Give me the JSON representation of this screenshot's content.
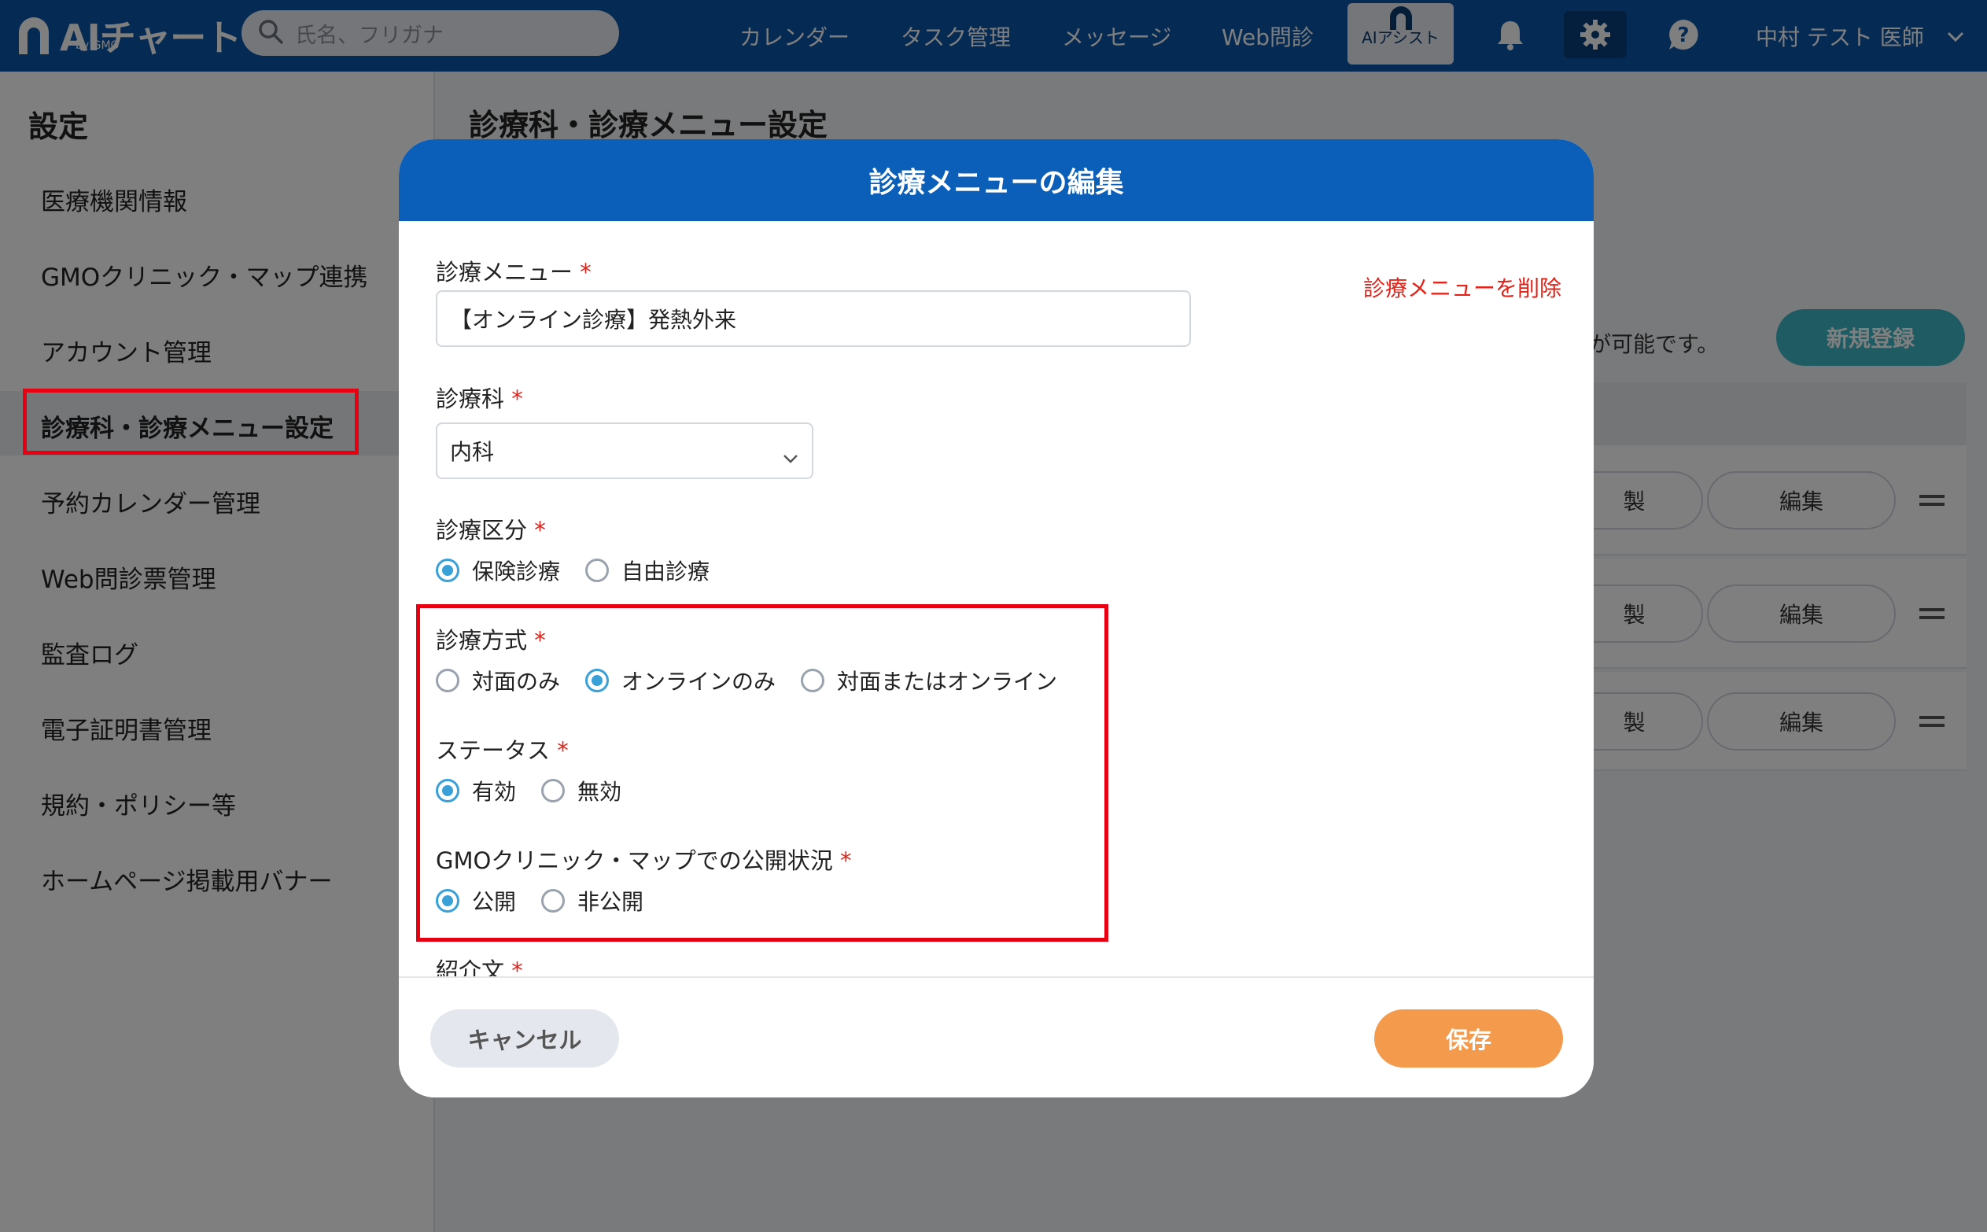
{
  "header": {
    "logo_text": "AIチャート",
    "logo_sub": "by GMO",
    "search_placeholder": "氏名、フリガナ",
    "nav": [
      "カレンダー",
      "タスク管理",
      "メッセージ",
      "Web問診"
    ],
    "ai_assist_label": "AIアシスト",
    "user_name": "中村 テスト 医師"
  },
  "sidebar": {
    "title": "設定",
    "items": [
      {
        "label": "医療機関情報"
      },
      {
        "label": "GMOクリニック・マップ連携"
      },
      {
        "label": "アカウント管理"
      },
      {
        "label": "診療科・診療メニュー設定"
      },
      {
        "label": "予約カレンダー管理"
      },
      {
        "label": "Web問診票管理"
      },
      {
        "label": "監査ログ"
      },
      {
        "label": "電子証明書管理"
      },
      {
        "label": "規約・ポリシー等"
      },
      {
        "label": "ホームページ掲載用バナー"
      }
    ]
  },
  "main": {
    "title": "診療科・診療メニュー設定",
    "note_fragment": "が可能です。",
    "new_button": "新規登録",
    "rows": [
      {
        "copy_fragment": "製",
        "edit": "編集"
      },
      {
        "copy_fragment": "製",
        "edit": "編集"
      },
      {
        "copy_fragment": "製",
        "edit": "編集"
      }
    ]
  },
  "modal": {
    "title": "診療メニューの編集",
    "delete_link": "診療メニューを削除",
    "required_mark": "*",
    "menu_label": "診療メニュー",
    "menu_value": "【オンライン診療】発熱外来",
    "dept_label": "診療科",
    "dept_value": "内科",
    "category_label": "診療区分",
    "category_options": [
      "保険診療",
      "自由診療"
    ],
    "method_label": "診療方式",
    "method_options": [
      "対面のみ",
      "オンラインのみ",
      "対面またはオンライン"
    ],
    "status_label": "ステータス",
    "status_options": [
      "有効",
      "無効"
    ],
    "publish_label": "GMOクリニック・マップでの公開状況",
    "publish_options": [
      "公開",
      "非公開"
    ],
    "intro_label": "紹介文",
    "cancel": "キャンセル",
    "save": "保存"
  }
}
